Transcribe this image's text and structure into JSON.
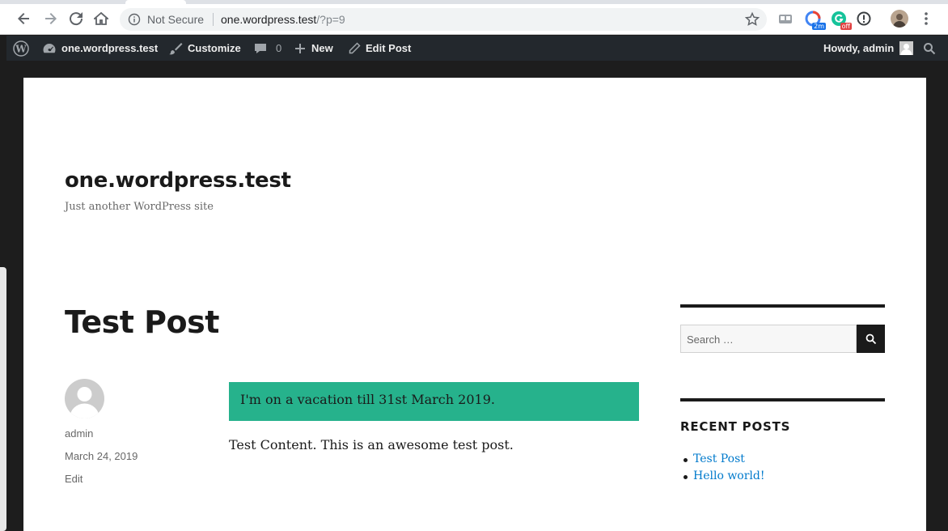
{
  "browser": {
    "security_label": "Not Secure",
    "url_host": "one.wordpress.test",
    "url_path": "/?p=9",
    "extensions": [
      {
        "name": "tab-extension",
        "badge": ""
      },
      {
        "name": "timer-extension",
        "badge": "2m"
      },
      {
        "name": "grammarly-extension",
        "badge": "off"
      },
      {
        "name": "info-extension",
        "badge": ""
      }
    ]
  },
  "adminbar": {
    "site_name": "one.wordpress.test",
    "customize": "Customize",
    "comments_count": "0",
    "new_label": "New",
    "edit_post": "Edit Post",
    "howdy": "Howdy, admin"
  },
  "site": {
    "title": "one.wordpress.test",
    "description": "Just another WordPress site"
  },
  "post": {
    "title": "Test Post",
    "author": "admin",
    "date": "March 24, 2019",
    "edit_label": "Edit",
    "notice": "I'm on a vacation till 31st March 2019.",
    "content": "Test Content. This is an awesome test post."
  },
  "sidebar": {
    "search_placeholder": "Search …",
    "recent_title": "RECENT POSTS",
    "recent_posts": [
      "Test Post",
      "Hello world!"
    ]
  },
  "colors": {
    "notice_bg": "#26b28c",
    "link": "#007acc",
    "adminbar_bg": "#23282d"
  }
}
